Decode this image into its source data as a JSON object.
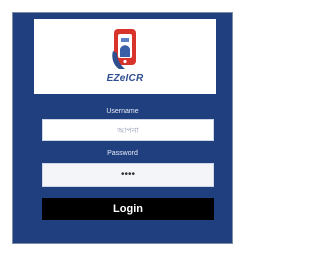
{
  "brand": {
    "name": "EZeICR",
    "logo_icon": "phone-in-hand-icon",
    "accent_color": "#d9342b",
    "text_color": "#2f4f8f"
  },
  "form": {
    "username_label": "Username",
    "username_placeholder": "আপনা",
    "password_label": "Password",
    "password_value": "••••",
    "login_label": "Login"
  },
  "colors": {
    "panel_bg": "#1f3f7e",
    "button_bg": "#000000",
    "button_text": "#ffffff"
  }
}
